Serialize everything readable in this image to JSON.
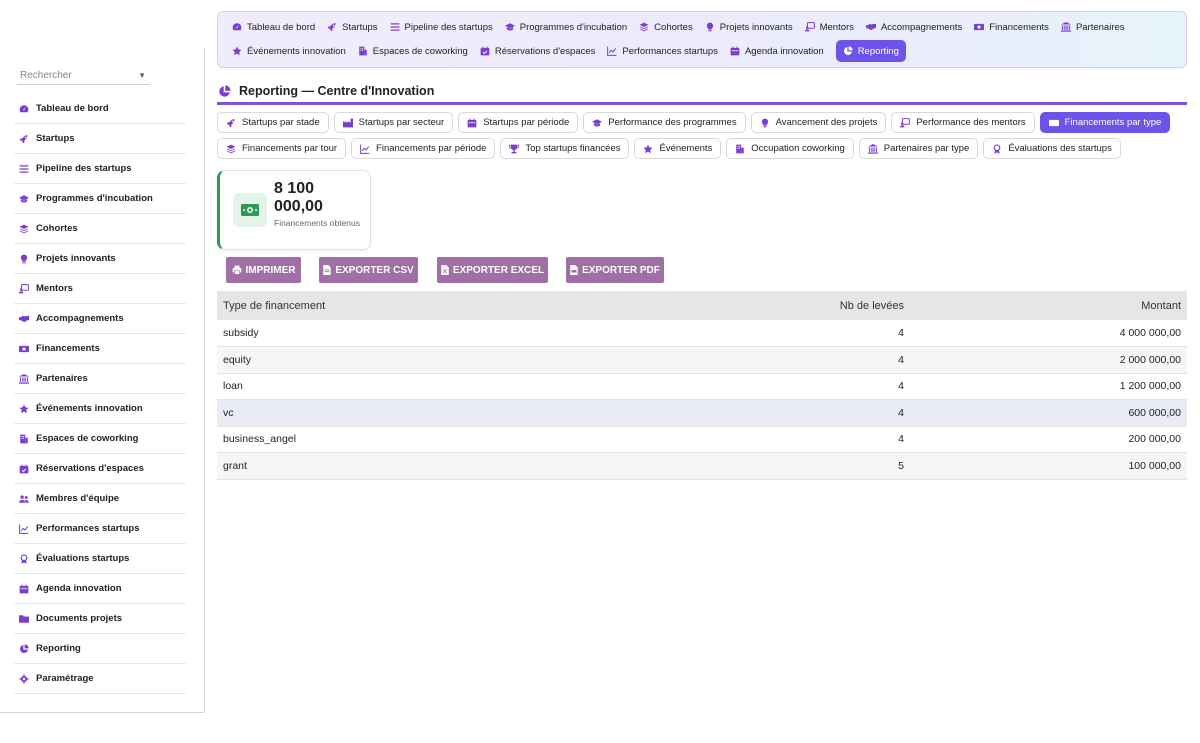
{
  "sidebar": {
    "search_placeholder": "Rechercher",
    "items": [
      {
        "label": "Tableau de bord",
        "icon": "gauge-icon"
      },
      {
        "label": "Startups",
        "icon": "rocket-icon"
      },
      {
        "label": "Pipeline des startups",
        "icon": "bars-icon"
      },
      {
        "label": "Programmes d'incubation",
        "icon": "graduation-cap-icon"
      },
      {
        "label": "Cohortes",
        "icon": "layers-icon"
      },
      {
        "label": "Projets innovants",
        "icon": "lightbulb-icon"
      },
      {
        "label": "Mentors",
        "icon": "chalkboard-user-icon"
      },
      {
        "label": "Accompagnements",
        "icon": "handshake-icon"
      },
      {
        "label": "Financements",
        "icon": "money-bill-icon"
      },
      {
        "label": "Partenaires",
        "icon": "bank-icon"
      },
      {
        "label": "Événements innovation",
        "icon": "star-icon"
      },
      {
        "label": "Espaces de coworking",
        "icon": "building-icon"
      },
      {
        "label": "Réservations d'espaces",
        "icon": "calendar-check-icon"
      },
      {
        "label": "Membres d'équipe",
        "icon": "users-icon"
      },
      {
        "label": "Performances startups",
        "icon": "chart-line-icon"
      },
      {
        "label": "Évaluations startups",
        "icon": "award-icon"
      },
      {
        "label": "Agenda innovation",
        "icon": "calendar-icon"
      },
      {
        "label": "Documents projets",
        "icon": "folder-icon"
      },
      {
        "label": "Reporting",
        "icon": "chart-pie-icon"
      },
      {
        "label": "Paramétrage",
        "icon": "gear-icon"
      }
    ]
  },
  "topnav": {
    "row1": [
      {
        "label": "Tableau de bord",
        "icon": "gauge-icon"
      },
      {
        "label": "Startups",
        "icon": "rocket-icon"
      },
      {
        "label": "Pipeline des startups",
        "icon": "bars-icon"
      },
      {
        "label": "Programmes d'incubation",
        "icon": "graduation-cap-icon"
      },
      {
        "label": "Cohortes",
        "icon": "layers-icon"
      },
      {
        "label": "Projets innovants",
        "icon": "lightbulb-icon"
      },
      {
        "label": "Mentors",
        "icon": "chalkboard-user-icon"
      },
      {
        "label": "Accompagnements",
        "icon": "handshake-icon"
      },
      {
        "label": "Financements",
        "icon": "money-bill-icon"
      },
      {
        "label": "Partenaires",
        "icon": "bank-icon"
      }
    ],
    "row2": [
      {
        "label": "Événements innovation",
        "icon": "star-icon"
      },
      {
        "label": "Espaces de coworking",
        "icon": "building-icon"
      },
      {
        "label": "Réservations d'espaces",
        "icon": "calendar-check-icon"
      },
      {
        "label": "Performances startups",
        "icon": "chart-line-icon"
      },
      {
        "label": "Agenda innovation",
        "icon": "calendar-icon"
      },
      {
        "label": "Reporting",
        "icon": "chart-pie-icon",
        "active": true
      }
    ]
  },
  "page": {
    "title": "Reporting — Centre d'Innovation"
  },
  "tabs": {
    "row1": [
      {
        "label": "Startups par stade",
        "icon": "rocket-icon"
      },
      {
        "label": "Startups par secteur",
        "icon": "industry-icon"
      },
      {
        "label": "Startups par période",
        "icon": "calendar-icon"
      },
      {
        "label": "Performance des programmes",
        "icon": "graduation-cap-icon"
      },
      {
        "label": "Avancement des projets",
        "icon": "lightbulb-icon"
      },
      {
        "label": "Performance des mentors",
        "icon": "chalkboard-user-icon"
      },
      {
        "label": "Financements par type",
        "icon": "money-bill-icon",
        "active": true
      }
    ],
    "row2": [
      {
        "label": "Financements par tour",
        "icon": "layers-icon"
      },
      {
        "label": "Financements par période",
        "icon": "chart-line-icon"
      },
      {
        "label": "Top startups financées",
        "icon": "trophy-icon"
      },
      {
        "label": "Événements",
        "icon": "star-icon"
      },
      {
        "label": "Occupation coworking",
        "icon": "building-icon"
      },
      {
        "label": "Partenaires par type",
        "icon": "bank-icon"
      },
      {
        "label": "Évaluations des startups",
        "icon": "award-icon"
      }
    ]
  },
  "kpi": {
    "value": "8 100 000,00",
    "label": "Financements obtenus",
    "icon": "money-bill-icon"
  },
  "buttons": {
    "print": "IMPRIMER",
    "csv": "EXPORTER CSV",
    "excel": "EXPORTER EXCEL",
    "pdf": "EXPORTER PDF"
  },
  "table": {
    "headers": [
      "Type de financement",
      "Nb de levées",
      "Montant"
    ],
    "rows": [
      [
        "subsidy",
        "4",
        "4 000 000,00"
      ],
      [
        "equity",
        "4",
        "2 000 000,00"
      ],
      [
        "loan",
        "4",
        "1 200 000,00"
      ],
      [
        "vc",
        "4",
        "600 000,00"
      ],
      [
        "business_angel",
        "4",
        "200 000,00"
      ],
      [
        "grant",
        "5",
        "100 000,00"
      ]
    ]
  },
  "colors": {
    "accent": "#6d53e8",
    "icon_purple": "#7b3fd0",
    "kpi_green": "#2e9a55",
    "button": "#a06fa5"
  }
}
